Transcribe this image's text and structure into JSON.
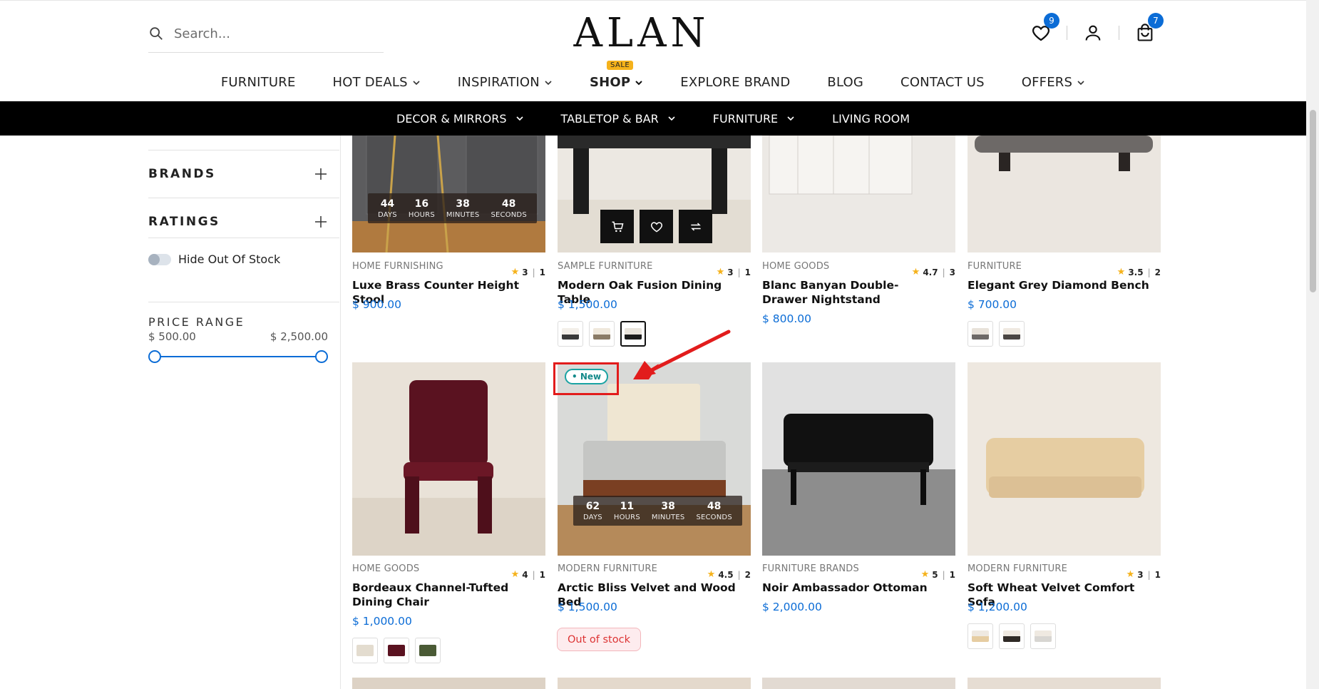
{
  "header": {
    "logo": "ALAN",
    "search_placeholder": "Search...",
    "wishlist_count": "9",
    "cart_count": "7"
  },
  "main_nav": [
    {
      "label": "FURNITURE"
    },
    {
      "label": "HOT DEALS"
    },
    {
      "label": "INSPIRATION"
    },
    {
      "label": "SHOP",
      "badge": "SALE"
    },
    {
      "label": "EXPLORE BRAND"
    },
    {
      "label": "BLOG"
    },
    {
      "label": "CONTACT US"
    },
    {
      "label": "OFFERS"
    }
  ],
  "sub_nav": [
    {
      "label": "DECOR & MIRRORS"
    },
    {
      "label": "TABLETOP & BAR"
    },
    {
      "label": "FURNITURE"
    },
    {
      "label": "LIVING ROOM"
    }
  ],
  "sidebar": {
    "brands": "BRANDS",
    "ratings": "RATINGS",
    "hide_out_of_stock": "Hide Out Of Stock",
    "price_range": "PRICE RANGE",
    "price_min": "$ 500.00",
    "price_max": "$ 2,500.00"
  },
  "timer_labels": {
    "days": "DAYS",
    "hours": "HOURS",
    "minutes": "MINUTES",
    "seconds": "SECONDS"
  },
  "products": [
    {
      "category": "HOME FURNISHING",
      "rating": "3",
      "reviews": "1",
      "name": "Luxe Brass Counter Height Stool",
      "price": "$ 900.00",
      "timer": {
        "days": "44",
        "hours": "16",
        "minutes": "38",
        "seconds": "48"
      }
    },
    {
      "category": "SAMPLE FURNITURE",
      "rating": "3",
      "reviews": "1",
      "name": "Modern Oak Fusion Dining Table",
      "price": "$ 1,500.00"
    },
    {
      "category": "HOME GOODS",
      "rating": "4.7",
      "reviews": "3",
      "name": "Blanc Banyan Double-Drawer Nightstand",
      "price": "$ 800.00"
    },
    {
      "category": "FURNITURE",
      "rating": "3.5",
      "reviews": "2",
      "name": "Elegant Grey Diamond Bench",
      "price": "$ 700.00"
    },
    {
      "category": "HOME GOODS",
      "rating": "4",
      "reviews": "1",
      "name": "Bordeaux Channel-Tufted Dining Chair",
      "price": "$ 1,000.00"
    },
    {
      "category": "MODERN FURNITURE",
      "rating": "4.5",
      "reviews": "2",
      "name": "Arctic Bliss Velvet and Wood Bed",
      "price": "$ 1,500.00",
      "badge": "New",
      "stock_status": "Out of stock",
      "timer": {
        "days": "62",
        "hours": "11",
        "minutes": "38",
        "seconds": "48"
      }
    },
    {
      "category": "FURNITURE BRANDS",
      "rating": "5",
      "reviews": "1",
      "name": "Noir Ambassador Ottoman",
      "price": "$ 2,000.00"
    },
    {
      "category": "MODERN FURNITURE",
      "rating": "3",
      "reviews": "1",
      "name": "Soft Wheat Velvet Comfort Sofa",
      "price": "$ 1,200.00"
    }
  ],
  "colors": {
    "accent": "#0b6cd6",
    "sale_badge": "#f5b21b",
    "annotation": "#e21c1c"
  }
}
